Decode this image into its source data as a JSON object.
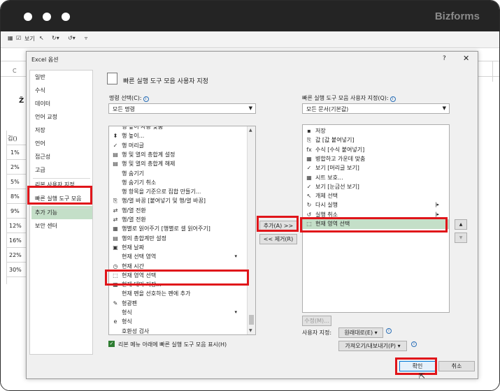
{
  "brand": "Bizforms",
  "qat": {
    "view_label": "보기"
  },
  "sheet": {
    "col_c": "C",
    "cells": [
      "김()",
      "1%",
      "2%",
      "5%",
      "8%",
      "9%",
      "12%",
      "16%",
      "22%",
      "30%"
    ],
    "title_char": "Ž"
  },
  "dialog": {
    "title": "Excel 옵션",
    "help": "?",
    "close": "✕",
    "nav": [
      "일반",
      "수식",
      "데이터",
      "언어 교정",
      "저장",
      "언어",
      "접근성",
      "고급",
      "리본 사용자 지정",
      "빠른 실행 도구 모음",
      "추가 기능",
      "보안 센터"
    ],
    "header": "빠른 실행 도구 모음 사용자 지정",
    "command_label": "명령 선택(C):",
    "command_value": "모든 명령",
    "custom_label": "빠른 실행 도구 모음 사용자 지정(Q):",
    "custom_value": "모든 문서(기본값)",
    "left_list": [
      {
        "icon": "",
        "text": "행 높이 자동 맞춤"
      },
      {
        "icon": "⬍",
        "text": "행 높이..."
      },
      {
        "icon": "✓",
        "text": "행 머리글"
      },
      {
        "icon": "▤",
        "text": "행 및 열의 총합계 설정"
      },
      {
        "icon": "▤",
        "text": "행 및 열의 총합계 해제"
      },
      {
        "icon": "",
        "text": "행 숨기기"
      },
      {
        "icon": "",
        "text": "행 숨기기 취소"
      },
      {
        "icon": "",
        "text": "행 항목을 기준으로 집합 만들기..."
      },
      {
        "icon": "⎘",
        "text": "행/열 바꿈 [붙여넣기 및 행/열 바꿈]"
      },
      {
        "icon": "⇄",
        "text": "행/열 전환"
      },
      {
        "icon": "⇄",
        "text": "행/열 전환"
      },
      {
        "icon": "▦",
        "text": "행별로 읽어주기 [행별로 셀 읽어주기]"
      },
      {
        "icon": "▤",
        "text": "행의 총합계만 설정"
      },
      {
        "icon": "▣",
        "text": "현재 날짜"
      },
      {
        "icon": "",
        "text": "현재 선택 영역",
        "sub": "▾"
      },
      {
        "icon": "◷",
        "text": "현재 시간"
      },
      {
        "icon": "⬚",
        "text": "현재 영역 선택"
      },
      {
        "icon": "▦",
        "text": "현재 테마 저장..."
      },
      {
        "icon": "",
        "text": "현재 펜을 선호하는 펜에 추가"
      },
      {
        "icon": "✎",
        "text": "형광펜"
      },
      {
        "icon": "",
        "text": "형식",
        "sub": "▾"
      },
      {
        "icon": "e",
        "text": "형식"
      },
      {
        "icon": "",
        "text": "호환성 검사"
      }
    ],
    "right_list": [
      {
        "icon": "▪",
        "text": "저장"
      },
      {
        "icon": "⎘",
        "text": "값 [값 붙여넣기]"
      },
      {
        "icon": "fx",
        "text": "수식 [수식 붙여넣기]"
      },
      {
        "icon": "▦",
        "text": "병합하고 가운데 맞춤"
      },
      {
        "icon": "✓",
        "text": "보기 [머리글 보기]"
      },
      {
        "icon": "▦",
        "text": "시트 보호..."
      },
      {
        "icon": "✓",
        "text": "보기 [눈금선 보기]"
      },
      {
        "icon": "↖",
        "text": "개체 선택"
      },
      {
        "icon": "↻",
        "text": "다시 실행",
        "sub": "|▸"
      },
      {
        "icon": "↺",
        "text": "실행 취소",
        "sub": "|▸"
      },
      {
        "icon": "⬚",
        "text": "현재 영역 선택"
      }
    ],
    "add_button": "추가(A) >>",
    "remove_button": "<< 제거(R)",
    "modify_button": "수정(M)...",
    "customize_label": "사용자 지정:",
    "reset_button": "원래대로(E) ▾",
    "import_button": "가져오기/내보내기(P) ▾",
    "checkbox_label": "리본 메뉴 아래에 빠른 실행 도구 모음 표시(H)",
    "ok_button": "확인",
    "cancel_button": "취소",
    "up_arrow": "▲",
    "down_arrow": "▼"
  },
  "colors": {
    "highlight": "#e0151a",
    "selection": "#c4dfc8",
    "topbar": "#242424"
  }
}
